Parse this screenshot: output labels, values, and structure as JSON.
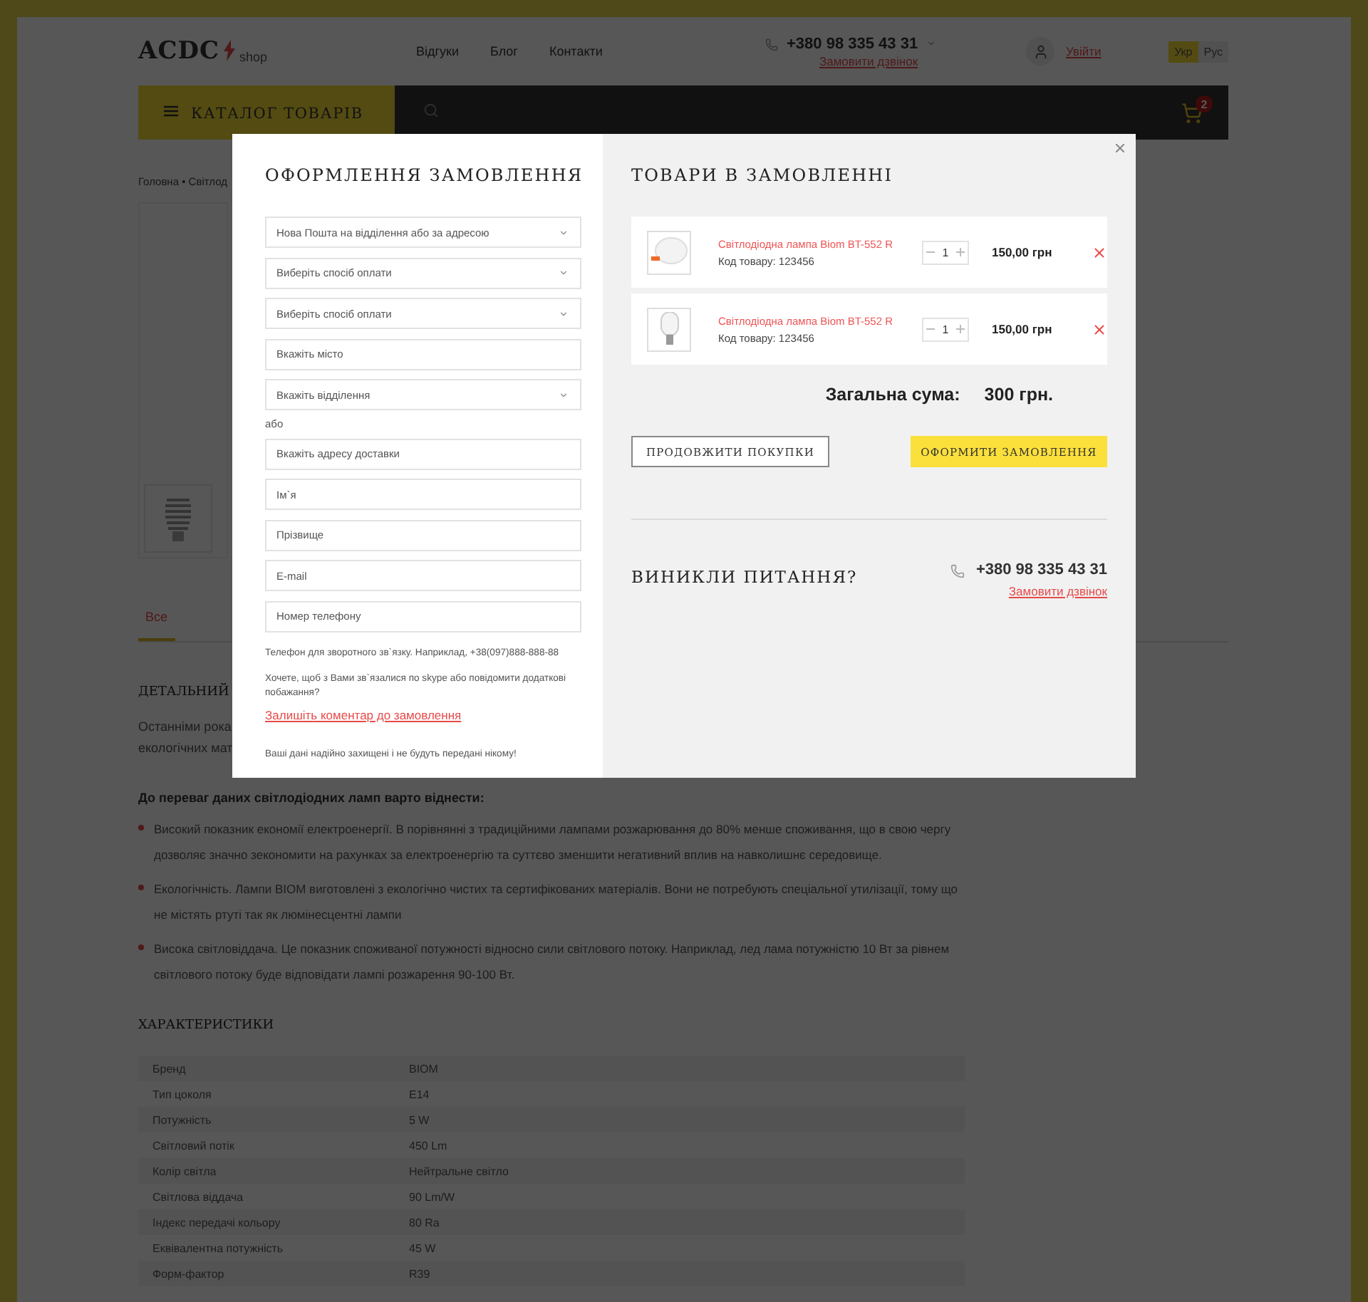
{
  "header": {
    "logo": {
      "text": "ACDC",
      "suffix": "shop"
    },
    "nav": [
      "Відгуки",
      "Блог",
      "Контакти"
    ],
    "contact": {
      "phone": "+380 98 335 43 31",
      "callback": "Замовити дзвінок"
    },
    "login": "Увійти",
    "languages": [
      {
        "label": "Укр",
        "selected": true
      },
      {
        "label": "Рус",
        "selected": false
      }
    ]
  },
  "navbar": {
    "catalog": "КАТАЛОГ ТОВАРІВ",
    "cart_count": "2"
  },
  "breadcrumbs": "Головна • Світлод",
  "product_tabs": [
    {
      "label": "Все",
      "selected": true
    }
  ],
  "description": {
    "title": "ДЕТАЛЬНИЙ",
    "lines": [
      "Останніми рока",
      "екологічних мат"
    ],
    "lead": "До переваг даних світлодіодних ламп варто віднести:",
    "bullets": [
      "Високий показник економії електроенергії. В порівнянні з традиційними лампами розжарювання до 80% менше споживання, що в свою чергу дозволяє значно зекономити на рахунках за електроенергію та суттєво зменшити негативний вплив на навколишнє середовище.",
      "Екологічність. Лампи BIOM виготовлені з екологічно чистих та сертифікованих матеріалів. Вони не потребують спеціальної утилізації, тому що не містять ртуті так як люмінесцентні лампи",
      "Висока світловіддача. Це показник споживаної потужності відносно сили світлового потоку. Наприклад, лед лама потужністю 10 Вт за рівнем світлового потоку буде відповідати лампі розжарення 90-100 Вт."
    ]
  },
  "characteristics": {
    "title": "ХАРАКТЕРИСТИКИ",
    "rows": [
      {
        "name": "Бренд",
        "value": "BIOM"
      },
      {
        "name": "Тип цоколя",
        "value": "E14"
      },
      {
        "name": "Потужність",
        "value": "5 W"
      },
      {
        "name": "Світловий потік",
        "value": "450 Lm"
      },
      {
        "name": "Колір світла",
        "value": "Нейтральне світло"
      },
      {
        "name": "Світлова віддача",
        "value": "90 Lm/W"
      },
      {
        "name": "Індекс передачі кольору",
        "value": "80 Ra"
      },
      {
        "name": "Еквівалентна потужність",
        "value": "45 W"
      },
      {
        "name": "Форм-фактор",
        "value": "R39"
      }
    ]
  },
  "modal": {
    "checkout": {
      "title": "ОФОРМЛЕННЯ ЗАМОВЛЕННЯ",
      "fields": [
        {
          "kind": "select",
          "text": "Нова Пошта на відділення або за адресою"
        },
        {
          "kind": "select",
          "text": "Виберіть спосіб оплати"
        },
        {
          "kind": "select",
          "text": "Виберіть спосіб оплати"
        },
        {
          "kind": "input",
          "placeholder": "Вкажіть місто"
        },
        {
          "kind": "select",
          "text": "Вкажіть відділення"
        },
        {
          "kind": "separator",
          "text": "або"
        },
        {
          "kind": "input",
          "placeholder": "Вкажіть адресу доставки"
        },
        {
          "kind": "input",
          "placeholder": "Ім`я"
        },
        {
          "kind": "input",
          "placeholder": "Прізвище"
        },
        {
          "kind": "input",
          "placeholder": "E-mail"
        },
        {
          "kind": "input",
          "placeholder": "Номер телефону"
        }
      ],
      "phone_hint": "Телефон для зворотного зв`язку. Наприклад, +38(097)888-888-88",
      "question": "Хочете, щоб з Вами зв`язалися по skype або повідомити додаткові побажання?",
      "comment_link": "Залишіть коментар до замовлення",
      "privacy": "Ваші дані надійно захищені і не будуть передані нікому!"
    },
    "cart": {
      "title": "ТОВАРИ В ЗАМОВЛЕННІ",
      "items": [
        {
          "kind": "panel",
          "name": "Світлодіодна лампа Biom BT-552 R",
          "code": "Код товару: 123456",
          "quantity": "1",
          "price": "150,00 грн"
        },
        {
          "kind": "bulb",
          "name": "Світлодіодна лампа Biom BT-552 R",
          "code": "Код товару: 123456",
          "quantity": "1",
          "price": "150,00 грн"
        }
      ],
      "total_label": "Загальна сума:",
      "total": "300 грн.",
      "continue_button": "ПРОДОВЖИТИ ПОКУПКИ",
      "order_button": "ОФОРМИТИ ЗАМОВЛЕННЯ"
    },
    "questions": {
      "title": "ВИНИКЛИ ПИТАННЯ?",
      "phone": "+380 98 335 43 31",
      "callback": "Замовити дзвінок"
    }
  }
}
